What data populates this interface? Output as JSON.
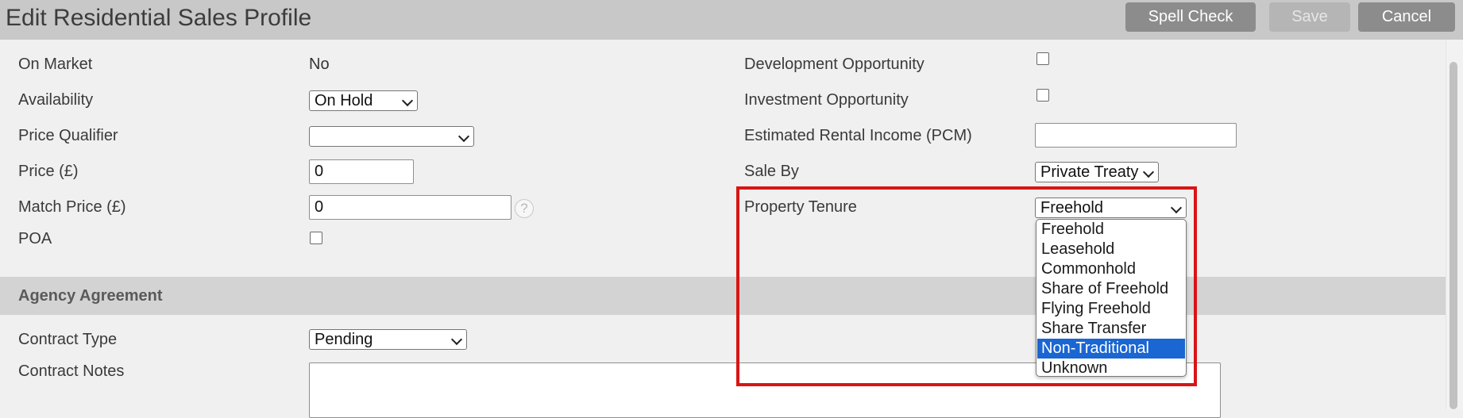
{
  "header": {
    "title": "Edit Residential Sales Profile",
    "spell_check_label": "Spell Check",
    "save_label": "Save",
    "cancel_label": "Cancel"
  },
  "fields": {
    "on_market": {
      "label": "On Market",
      "value": "No"
    },
    "availability": {
      "label": "Availability",
      "value": "On Hold"
    },
    "price_qualifier": {
      "label": "Price Qualifier",
      "value": ""
    },
    "price": {
      "label": "Price (£)",
      "value": "0"
    },
    "match_price": {
      "label": "Match Price (£)",
      "value": "0",
      "help": "?"
    },
    "poa": {
      "label": "POA",
      "checked": false
    },
    "development_opportunity": {
      "label": "Development Opportunity",
      "checked": false
    },
    "investment_opportunity": {
      "label": "Investment Opportunity",
      "checked": false
    },
    "estimated_rental_income": {
      "label": "Estimated Rental Income (PCM)",
      "value": ""
    },
    "sale_by": {
      "label": "Sale By",
      "value": "Private Treaty"
    },
    "property_tenure": {
      "label": "Property Tenure",
      "value": "Freehold",
      "options": [
        "Freehold",
        "Leasehold",
        "Commonhold",
        "Share of Freehold",
        "Flying Freehold",
        "Share Transfer",
        "Non-Traditional",
        "Unknown"
      ],
      "highlighted_option": "Non-Traditional"
    }
  },
  "agency_agreement": {
    "section_title": "Agency Agreement",
    "contract_type": {
      "label": "Contract Type",
      "value": "Pending"
    },
    "contract_notes": {
      "label": "Contract Notes",
      "value": ""
    }
  },
  "colors": {
    "highlight_border": "#d81515",
    "selected_option": "#1a66d2",
    "header_bg": "#c8c8c8",
    "button_bg": "#8c8c8c"
  }
}
